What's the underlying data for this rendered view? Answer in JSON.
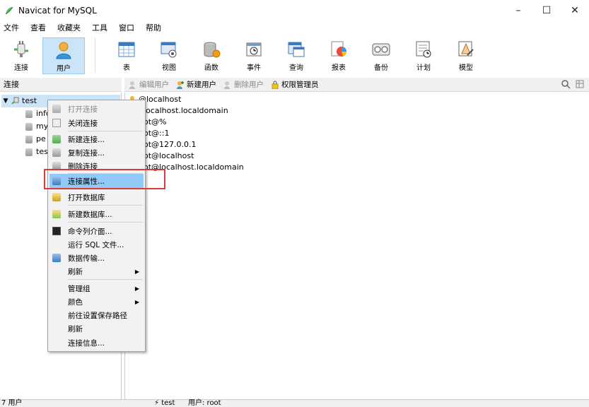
{
  "window": {
    "title": "Navicat for MySQL",
    "minimize": "–",
    "maximize": "☐",
    "close": "✕"
  },
  "menu": [
    "文件",
    "查看",
    "收藏夹",
    "工具",
    "窗口",
    "帮助"
  ],
  "toolbar": [
    {
      "label": "连接",
      "icon": "plug-icon"
    },
    {
      "label": "用户",
      "icon": "user-icon",
      "active": true
    },
    {
      "label": "表",
      "icon": "table-icon"
    },
    {
      "label": "视图",
      "icon": "view-icon"
    },
    {
      "label": "函数",
      "icon": "function-icon"
    },
    {
      "label": "事件",
      "icon": "event-icon"
    },
    {
      "label": "查询",
      "icon": "query-icon"
    },
    {
      "label": "报表",
      "icon": "report-icon"
    },
    {
      "label": "备份",
      "icon": "backup-icon"
    },
    {
      "label": "计划",
      "icon": "schedule-icon"
    },
    {
      "label": "模型",
      "icon": "model-icon"
    }
  ],
  "left_panel": {
    "header": "连接",
    "connection": "test",
    "databases": [
      "info",
      "my",
      "pe",
      "tes"
    ]
  },
  "right_panel": {
    "actions": {
      "edit_user": "编辑用户",
      "new_user": "新建用户",
      "delete_user": "删除用户",
      "privilege_manager": "权限管理员"
    },
    "users": [
      "@localhost",
      "@localhost.localdomain",
      "root@%",
      "root@::1",
      "root@127.0.0.1",
      "root@localhost",
      "root@localhost.localdomain"
    ],
    "users_visible": [
      "@localhost",
      "localhost.localdomain",
      "ot@%",
      "ot@::1",
      "ot@127.0.0.1",
      "ot@localhost",
      "ot@localhost.localdomain"
    ]
  },
  "context_menu": {
    "items": [
      {
        "label": "打开连接",
        "disabled": true
      },
      {
        "label": "关闭连接"
      },
      {
        "label": "新建连接..."
      },
      {
        "label": "复制连接..."
      },
      {
        "label": "删除连接"
      },
      {
        "label": "连接属性...",
        "highlighted": true
      },
      {
        "label": "打开数据库"
      },
      {
        "label": "新建数据库..."
      },
      {
        "label": "命令列介面..."
      },
      {
        "label": "运行 SQL 文件..."
      },
      {
        "label": "数据传输..."
      },
      {
        "label": "刷新",
        "submenu": true
      },
      {
        "label": "管理组",
        "submenu": true
      },
      {
        "label": "颜色",
        "submenu": true
      },
      {
        "label": "前往设置保存路径"
      },
      {
        "label": "刷新"
      },
      {
        "label": "连接信息..."
      }
    ]
  },
  "statusbar": {
    "count": "7 用户",
    "connection": "test",
    "user": "用户: root"
  },
  "colors": {
    "selection": "#cce4f7",
    "highlight": "#91c9f7",
    "annotation": "#d93a3a"
  }
}
